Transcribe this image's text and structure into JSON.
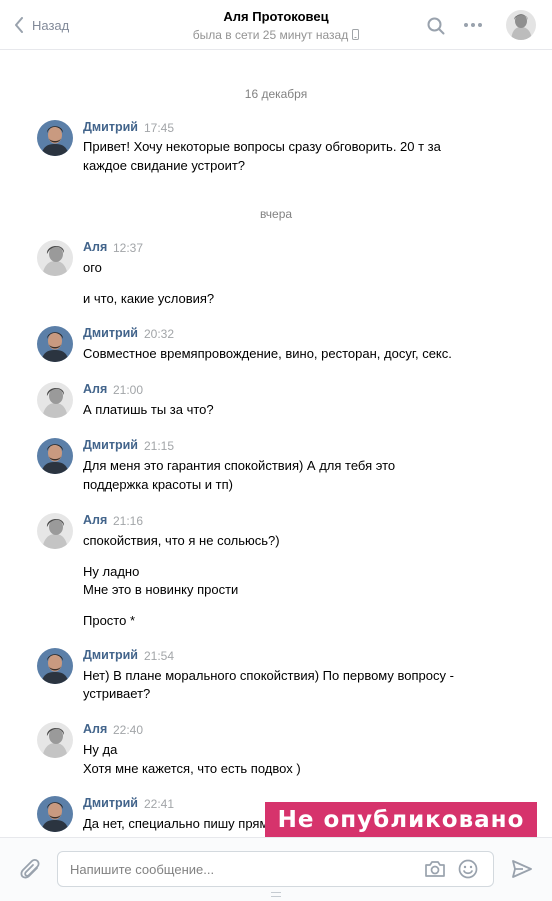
{
  "header": {
    "back_label": "Назад",
    "contact_name": "Аля Протоковец",
    "status": "была в сети 25 минут назад"
  },
  "composer": {
    "placeholder": "Напишите сообщение..."
  },
  "watermark": "Не опубликовано",
  "dates": [
    "16 декабря",
    "вчера"
  ],
  "messages": [
    {
      "author": "Дмитрий",
      "time": "17:45",
      "lines": [
        "Привет! Хочу некоторые вопросы сразу обговорить. 20 т за",
        "каждое свидание устроит?"
      ]
    },
    {
      "author": "Аля",
      "time": "12:37",
      "lines": [
        "ого",
        "и что, какие условия?"
      ]
    },
    {
      "author": "Дмитрий",
      "time": "20:32",
      "lines": [
        "Совместное времяпровождение, вино, ресторан, досуг, секс."
      ]
    },
    {
      "author": "Аля",
      "time": "21:00",
      "lines": [
        "А платишь ты за что?"
      ]
    },
    {
      "author": "Дмитрий",
      "time": "21:15",
      "lines": [
        "Для меня это гарантия спокойствия) А для тебя это",
        "поддержка красоты и тп)"
      ]
    },
    {
      "author": "Аля",
      "time": "21:16",
      "lines": [
        "спокойствия, что я не сольюсь?)",
        "Ну ладно",
        "Мне это в новинку прости",
        "Просто *"
      ]
    },
    {
      "author": "Дмитрий",
      "time": "21:54",
      "lines": [
        "Нет) В плане морального спокойствия) По первому вопросу -",
        "устривает?"
      ]
    },
    {
      "author": "Аля",
      "time": "22:40",
      "lines": [
        "Ну да",
        "Хотя мне кажется, что есть подвох )"
      ]
    },
    {
      "author": "Дмитрий",
      "time": "22:41",
      "lines": [
        "Да нет, специально пишу прям"
      ]
    }
  ],
  "colors": {
    "accent": "#42648b",
    "watermark_bg": "#d6336c",
    "muted": "#828a99"
  }
}
